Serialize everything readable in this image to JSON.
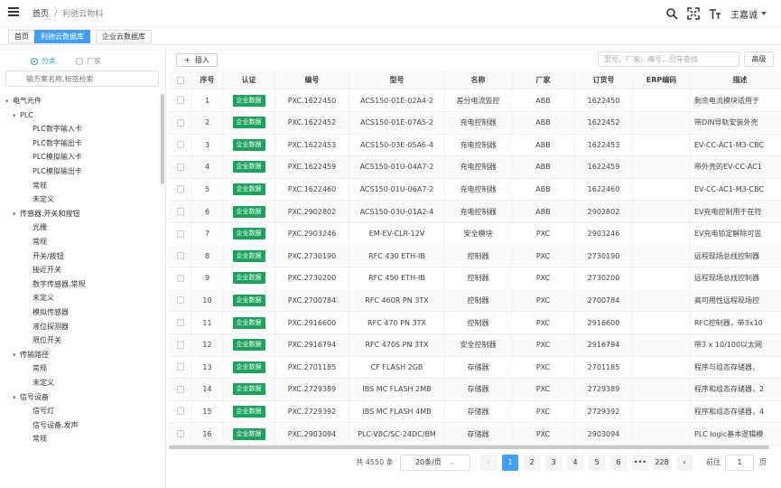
{
  "breadcrumb": {
    "home": "首页",
    "separator": "/",
    "current": "利驰云物料"
  },
  "user": {
    "name": "王嘉诚"
  },
  "header_icons": [
    "search-icon",
    "fullscreen-icon",
    "font-size-icon"
  ],
  "tabs": [
    {
      "label": "首页",
      "active": false
    },
    {
      "label": "利驰云数据库",
      "active": true
    },
    {
      "label": "企业云数据库",
      "active": false
    }
  ],
  "sidebar": {
    "radio_category": "分类",
    "radio_vendor": "厂家",
    "search_placeholder": "输方案名称,标签检索",
    "tree": [
      {
        "label": "电气元件",
        "level": 0,
        "caret": "▾"
      },
      {
        "label": "PLC",
        "level": 1,
        "caret": "▾"
      },
      {
        "label": "PLC数字输入卡",
        "level": 2,
        "caret": ""
      },
      {
        "label": "PLC数字输出卡",
        "level": 2,
        "caret": ""
      },
      {
        "label": "PLC模拟输入卡",
        "level": 2,
        "caret": ""
      },
      {
        "label": "PLC模拟输出卡",
        "level": 2,
        "caret": ""
      },
      {
        "label": "常规",
        "level": 2,
        "caret": ""
      },
      {
        "label": "未定义",
        "level": 2,
        "caret": ""
      },
      {
        "label": "传感器,开关和按钮",
        "level": 1,
        "caret": "▾"
      },
      {
        "label": "光栅",
        "level": 2,
        "caret": ""
      },
      {
        "label": "常规",
        "level": 2,
        "caret": ""
      },
      {
        "label": "开关/按钮",
        "level": 2,
        "caret": ""
      },
      {
        "label": "接近开关",
        "level": 2,
        "caret": ""
      },
      {
        "label": "数字传感器,常规",
        "level": 2,
        "caret": ""
      },
      {
        "label": "未定义",
        "level": 2,
        "caret": ""
      },
      {
        "label": "模拟传感器",
        "level": 2,
        "caret": ""
      },
      {
        "label": "液位探测器",
        "level": 2,
        "caret": ""
      },
      {
        "label": "限位开关",
        "level": 2,
        "caret": ""
      },
      {
        "label": "传输路径",
        "level": 1,
        "caret": "▾"
      },
      {
        "label": "常规",
        "level": 2,
        "caret": ""
      },
      {
        "label": "未定义",
        "level": 2,
        "caret": ""
      },
      {
        "label": "信号设备",
        "level": 1,
        "caret": "▾"
      },
      {
        "label": "信号灯",
        "level": 2,
        "caret": ""
      },
      {
        "label": "信号设备,发声",
        "level": 2,
        "caret": ""
      },
      {
        "label": "常规",
        "level": 2,
        "caret": ""
      }
    ]
  },
  "toolbar": {
    "insert_label": "插入",
    "search_placeholder": "型号、厂家、编号…回车查找",
    "advanced_label": "高级"
  },
  "table": {
    "headers": [
      "序号",
      "认证",
      "编号",
      "型号",
      "名称",
      "厂家",
      "订货号",
      "ERP编码",
      "描述"
    ],
    "rows": [
      [
        "1",
        "企业数据",
        "PXC.1622450",
        "ACS150-01E-02A4-2",
        "差分电流监控",
        "ABB",
        "1622450",
        "",
        "剩余电流模块适用于"
      ],
      [
        "2",
        "企业数据",
        "PXC.1622452",
        "ACS150-01E-07A5-2",
        "充电控制器",
        "ABB",
        "1622452",
        "",
        "带DIN导轨安装外壳"
      ],
      [
        "3",
        "企业数据",
        "PXC.1622453",
        "ACS150-03E-05A6-4",
        "充电控制器",
        "ABB",
        "1622453",
        "",
        "EV-CC-AC1-M3-CBC"
      ],
      [
        "4",
        "企业数据",
        "PXC.1622459",
        "ACS150-01U-04A7-2",
        "充电控制器",
        "ABB",
        "1622459",
        "",
        "带外壳的EV-CC-AC1"
      ],
      [
        "5",
        "企业数据",
        "PXC.1622460",
        "ACS150-01U-06A7-2",
        "充电控制器",
        "ABB",
        "1622460",
        "",
        "EV-CC-AC1-M3-CBC"
      ],
      [
        "6",
        "企业数据",
        "PXC.2902802",
        "ACS150-03U-01A2-4",
        "充电控制器",
        "ABB",
        "2902802",
        "",
        "EV充电控制用于在符"
      ],
      [
        "7",
        "企业数据",
        "PXC.2903246",
        "EM-EV-CLR-12V",
        "安全模块",
        "PXC",
        "2903246",
        "",
        "EV充电锁定解除可监"
      ],
      [
        "8",
        "企业数据",
        "PXC.2730190",
        "RFC 430 ETH-IB",
        "控制器",
        "PXC",
        "2730190",
        "",
        "远程现场总线控制器"
      ],
      [
        "9",
        "企业数据",
        "PXC.2730200",
        "RFC 450 ETH-IB",
        "控制器",
        "PXC",
        "2730200",
        "",
        "远程现场总线控制器"
      ],
      [
        "10",
        "企业数据",
        "PXC.2700784",
        "RFC 460R PN 3TX",
        "控制器",
        "PXC",
        "2700784",
        "",
        "高可用性远程现场控"
      ],
      [
        "11",
        "企业数据",
        "PXC.2916600",
        "RFC 470 PN 3TX",
        "控制器",
        "PXC",
        "2916600",
        "",
        "RFC控制器，带3x10"
      ],
      [
        "12",
        "企业数据",
        "PXC.2916794",
        "RFC 470S PN 3TX",
        "安全控制器",
        "PXC",
        "2916794",
        "",
        "带3 x 10/100以太网"
      ],
      [
        "13",
        "企业数据",
        "PXC.2701185",
        "CF FLASH 2GB",
        "存储器",
        "PXC",
        "2701185",
        "",
        "程序与组态存储器，"
      ],
      [
        "14",
        "企业数据",
        "PXC.2729389",
        "IBS MC FLASH 2MB",
        "存储器",
        "PXC",
        "2729389",
        "",
        "程序和组态存储器，2"
      ],
      [
        "15",
        "企业数据",
        "PXC.2729392",
        "IBS MC FLASH 4MB",
        "存储器",
        "PXC",
        "2729392",
        "",
        "程序和组态存储器，4"
      ],
      [
        "16",
        "企业数据",
        "PXC.2903094",
        "PLC-V8C/SC-24DC/BM",
        "存储器",
        "PXC",
        "2903094",
        "",
        "PLC logic基本逻辑模"
      ]
    ]
  },
  "pagination": {
    "total": "共 4550 条",
    "page_size": "20条/页",
    "prev": "‹",
    "pages": [
      "1",
      "2",
      "3",
      "4",
      "5",
      "6",
      "•••",
      "228"
    ],
    "active_page": "1",
    "next": "›",
    "goto_label": "前往",
    "goto_value": "1",
    "page_suffix": "页"
  },
  "colors": {
    "accent": "#409eff",
    "badge": "#1aa35a"
  }
}
